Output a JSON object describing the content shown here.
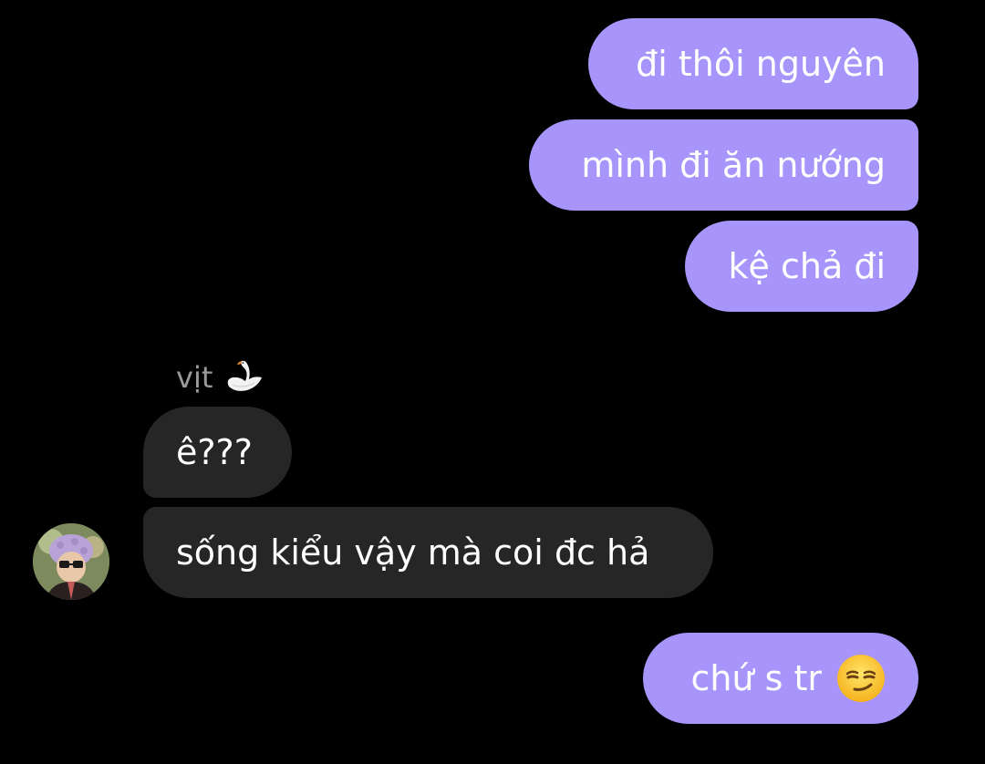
{
  "conversation": {
    "messages": [
      {
        "direction": "outgoing",
        "text": "đi thôi nguyên"
      },
      {
        "direction": "outgoing",
        "text": "mình đi ăn nướng"
      },
      {
        "direction": "outgoing",
        "text": "kệ chả đi"
      },
      {
        "direction": "incoming",
        "text": "ê???"
      },
      {
        "direction": "incoming",
        "text": "sống kiểu vậy mà coi đc hả"
      },
      {
        "direction": "outgoing",
        "text": "chứ s tr",
        "emoji": "smirk-emoji"
      }
    ],
    "sender_group": {
      "name": "vịt",
      "icon": "swan-emoji"
    },
    "avatar": {
      "icon": "avatar-photo"
    }
  },
  "colors": {
    "background": "#000000",
    "outgoing_bubble": "#a895fb",
    "incoming_bubble": "#262626",
    "sender_name": "#9a9a9a",
    "text": "#ffffff"
  }
}
